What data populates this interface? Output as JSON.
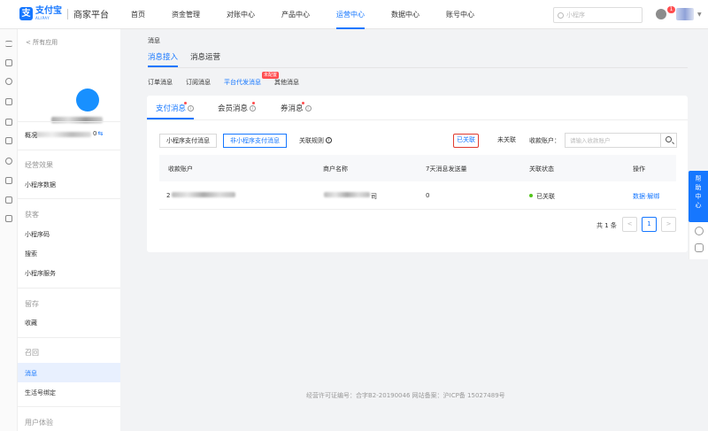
{
  "brand": {
    "logo_cn": "支付宝",
    "logo_en": "ALIPAY",
    "title": "商家平台",
    "color": "#1677ff"
  },
  "topnav": {
    "items": [
      {
        "label": "首页"
      },
      {
        "label": "资金管理"
      },
      {
        "label": "对账中心"
      },
      {
        "label": "产品中心"
      },
      {
        "label": "运营中心",
        "active": true
      },
      {
        "label": "数据中心"
      },
      {
        "label": "账号中心"
      }
    ],
    "search_placeholder": "小程序",
    "notification_count": "1"
  },
  "sidebar": {
    "back_label": "< 所有应用",
    "account_suffix": "0",
    "account_switch_icon": "⇆",
    "overview": "概况",
    "groups": [
      {
        "title": "经营效果",
        "items": [
          "小程序数据"
        ]
      },
      {
        "title": "获客",
        "items": [
          "小程序码",
          "搜索",
          "小程序服务"
        ]
      },
      {
        "title": "留存",
        "items": [
          "收藏"
        ]
      },
      {
        "title": "召回",
        "items": [
          "消息",
          "生活号绑定"
        ]
      },
      {
        "title": "用户体验",
        "items": []
      }
    ],
    "active_item": "消息"
  },
  "page": {
    "breadcrumb": "消息",
    "tabs": [
      "消息接入",
      "消息运营"
    ],
    "active_tab": "消息接入",
    "sub_tabs": [
      "订单消息",
      "订阅消息",
      "平台代发消息",
      "其他消息"
    ],
    "active_sub_tab": "平台代发消息",
    "new_badge": "未配置"
  },
  "card": {
    "tabs": [
      "支付消息",
      "会员消息",
      "券消息"
    ],
    "active_tab": "支付消息",
    "segments": [
      "小程序支付消息",
      "非小程序支付消息"
    ],
    "active_segment": "非小程序支付消息",
    "rule_link": "关联规则",
    "filters": [
      "已关联",
      "未关联"
    ],
    "highlighted_filter": "已关联",
    "account_label": "收款账户：",
    "account_placeholder": "请输入收款账户",
    "table": {
      "columns": [
        "收款账户",
        "商户名称",
        "7天消息发送量",
        "关联状态",
        "操作"
      ],
      "rows": [
        {
          "account_prefix": "2",
          "merchant_suffix": "司",
          "sent_7d": "0",
          "status": "已关联",
          "op_data": "数据",
          "op_sep": "·",
          "op_unbind": "解绑"
        }
      ]
    },
    "pagination": {
      "total": "共 1 条",
      "prev": "<",
      "current": "1",
      "next": ">"
    }
  },
  "footer": "经营许可证编号：合字B2-20190046 网站备案：沪ICP备 15027489号",
  "help": {
    "label": "帮助中心"
  },
  "colors": {
    "accent": "#1677ff",
    "danger": "#ff4d4f",
    "success": "#52c41a",
    "highlight_border": "#e03b2f"
  }
}
